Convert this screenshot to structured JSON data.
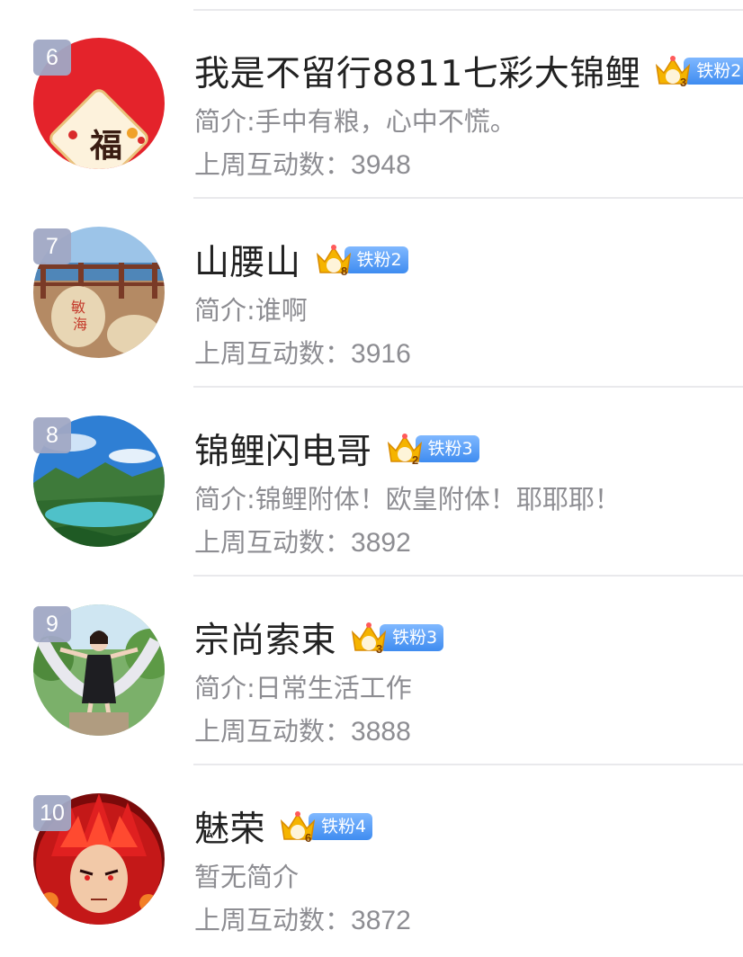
{
  "colors": {
    "rank_badge_bg": "#a0a8c4",
    "name_text": "#222222",
    "secondary_text": "#8d8d92",
    "fan_badge_blue": "#3f8cf0",
    "crown_gold": "#f5b400"
  },
  "users": [
    {
      "rank": "6",
      "name": "我是不留行8811七彩大锦鲤",
      "crown_number": "3",
      "badge_label": "铁粉2",
      "intro": "简介:手中有粮，心中不慌。",
      "interaction_label": "上周互动数：",
      "interaction_count": "3948",
      "avatar_icon": "fu-blessing-avatar"
    },
    {
      "rank": "7",
      "name": "山腰山",
      "crown_number": "8",
      "badge_label": "铁粉2",
      "intro": "简介:谁啊",
      "interaction_label": "上周互动数：",
      "interaction_count": "3916",
      "avatar_icon": "seaside-rock-avatar"
    },
    {
      "rank": "8",
      "name": "锦鲤闪电哥",
      "crown_number": "2",
      "badge_label": "铁粉3",
      "intro": "简介:锦鲤附体！欧皇附体！耶耶耶！",
      "interaction_label": "上周互动数：",
      "interaction_count": "3892",
      "avatar_icon": "mountain-lake-avatar"
    },
    {
      "rank": "9",
      "name": "宗尚索束",
      "crown_number": "3",
      "badge_label": "铁粉3",
      "intro": "简介:日常生活工作",
      "interaction_label": "上周互动数：",
      "interaction_count": "3888",
      "avatar_icon": "person-on-swing-avatar"
    },
    {
      "rank": "10",
      "name": "魅荣",
      "crown_number": "6",
      "badge_label": "铁粉4",
      "intro": "暂无简介",
      "interaction_label": "上周互动数：",
      "interaction_count": "3872",
      "avatar_icon": "anime-character-avatar"
    }
  ]
}
